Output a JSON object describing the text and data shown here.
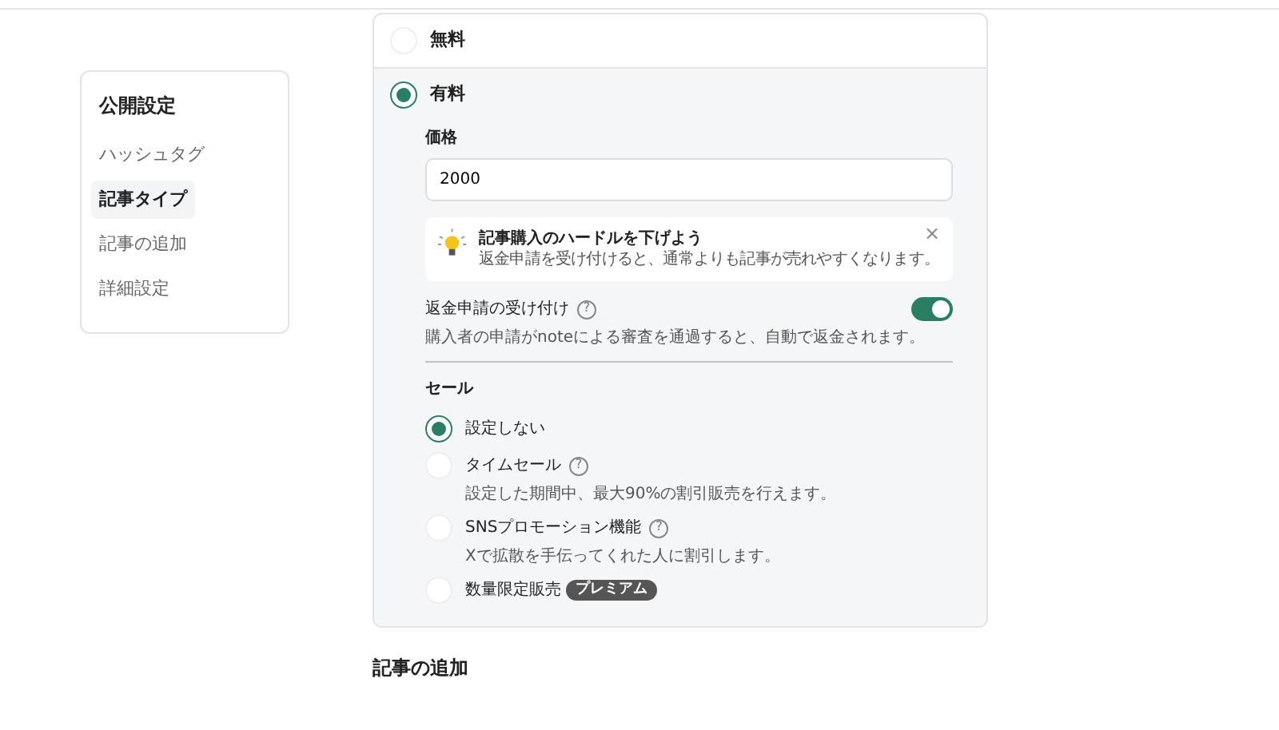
{
  "sidebar": {
    "title": "公開設定",
    "items": [
      {
        "label": "ハッシュタグ",
        "selected": false
      },
      {
        "label": "記事タイプ",
        "selected": true
      },
      {
        "label": "記事の追加",
        "selected": false
      },
      {
        "label": "詳細設定",
        "selected": false
      }
    ]
  },
  "price_options": [
    {
      "label": "無料",
      "selected": false
    },
    {
      "label": "有料",
      "selected": true
    }
  ],
  "price": {
    "label": "価格",
    "value": "2000"
  },
  "tip": {
    "title": "記事購入のハードルを下げよう",
    "text": "返金申請を受け付けると、通常よりも記事が売れやすくなります。",
    "close": "×"
  },
  "refund": {
    "label": "返金申請の受け付け",
    "help": "?",
    "on": true,
    "description": "購入者の申請がnoteによる審査を通過すると、自動で返金されます。"
  },
  "sale": {
    "title": "セール",
    "options": [
      {
        "label": "設定しない",
        "selected": true
      },
      {
        "label": "タイムセール",
        "help": "?",
        "description": "設定した期間中、最大90%の割引販売を行えます。",
        "selected": false
      },
      {
        "label": "SNSプロモーション機能",
        "help": "?",
        "description": "Xで拡散を手伝ってくれた人に割引します。",
        "selected": false
      },
      {
        "label": "数量限定販売",
        "badge": "プレミアム",
        "selected": false
      }
    ]
  },
  "next_section": "記事の追加"
}
